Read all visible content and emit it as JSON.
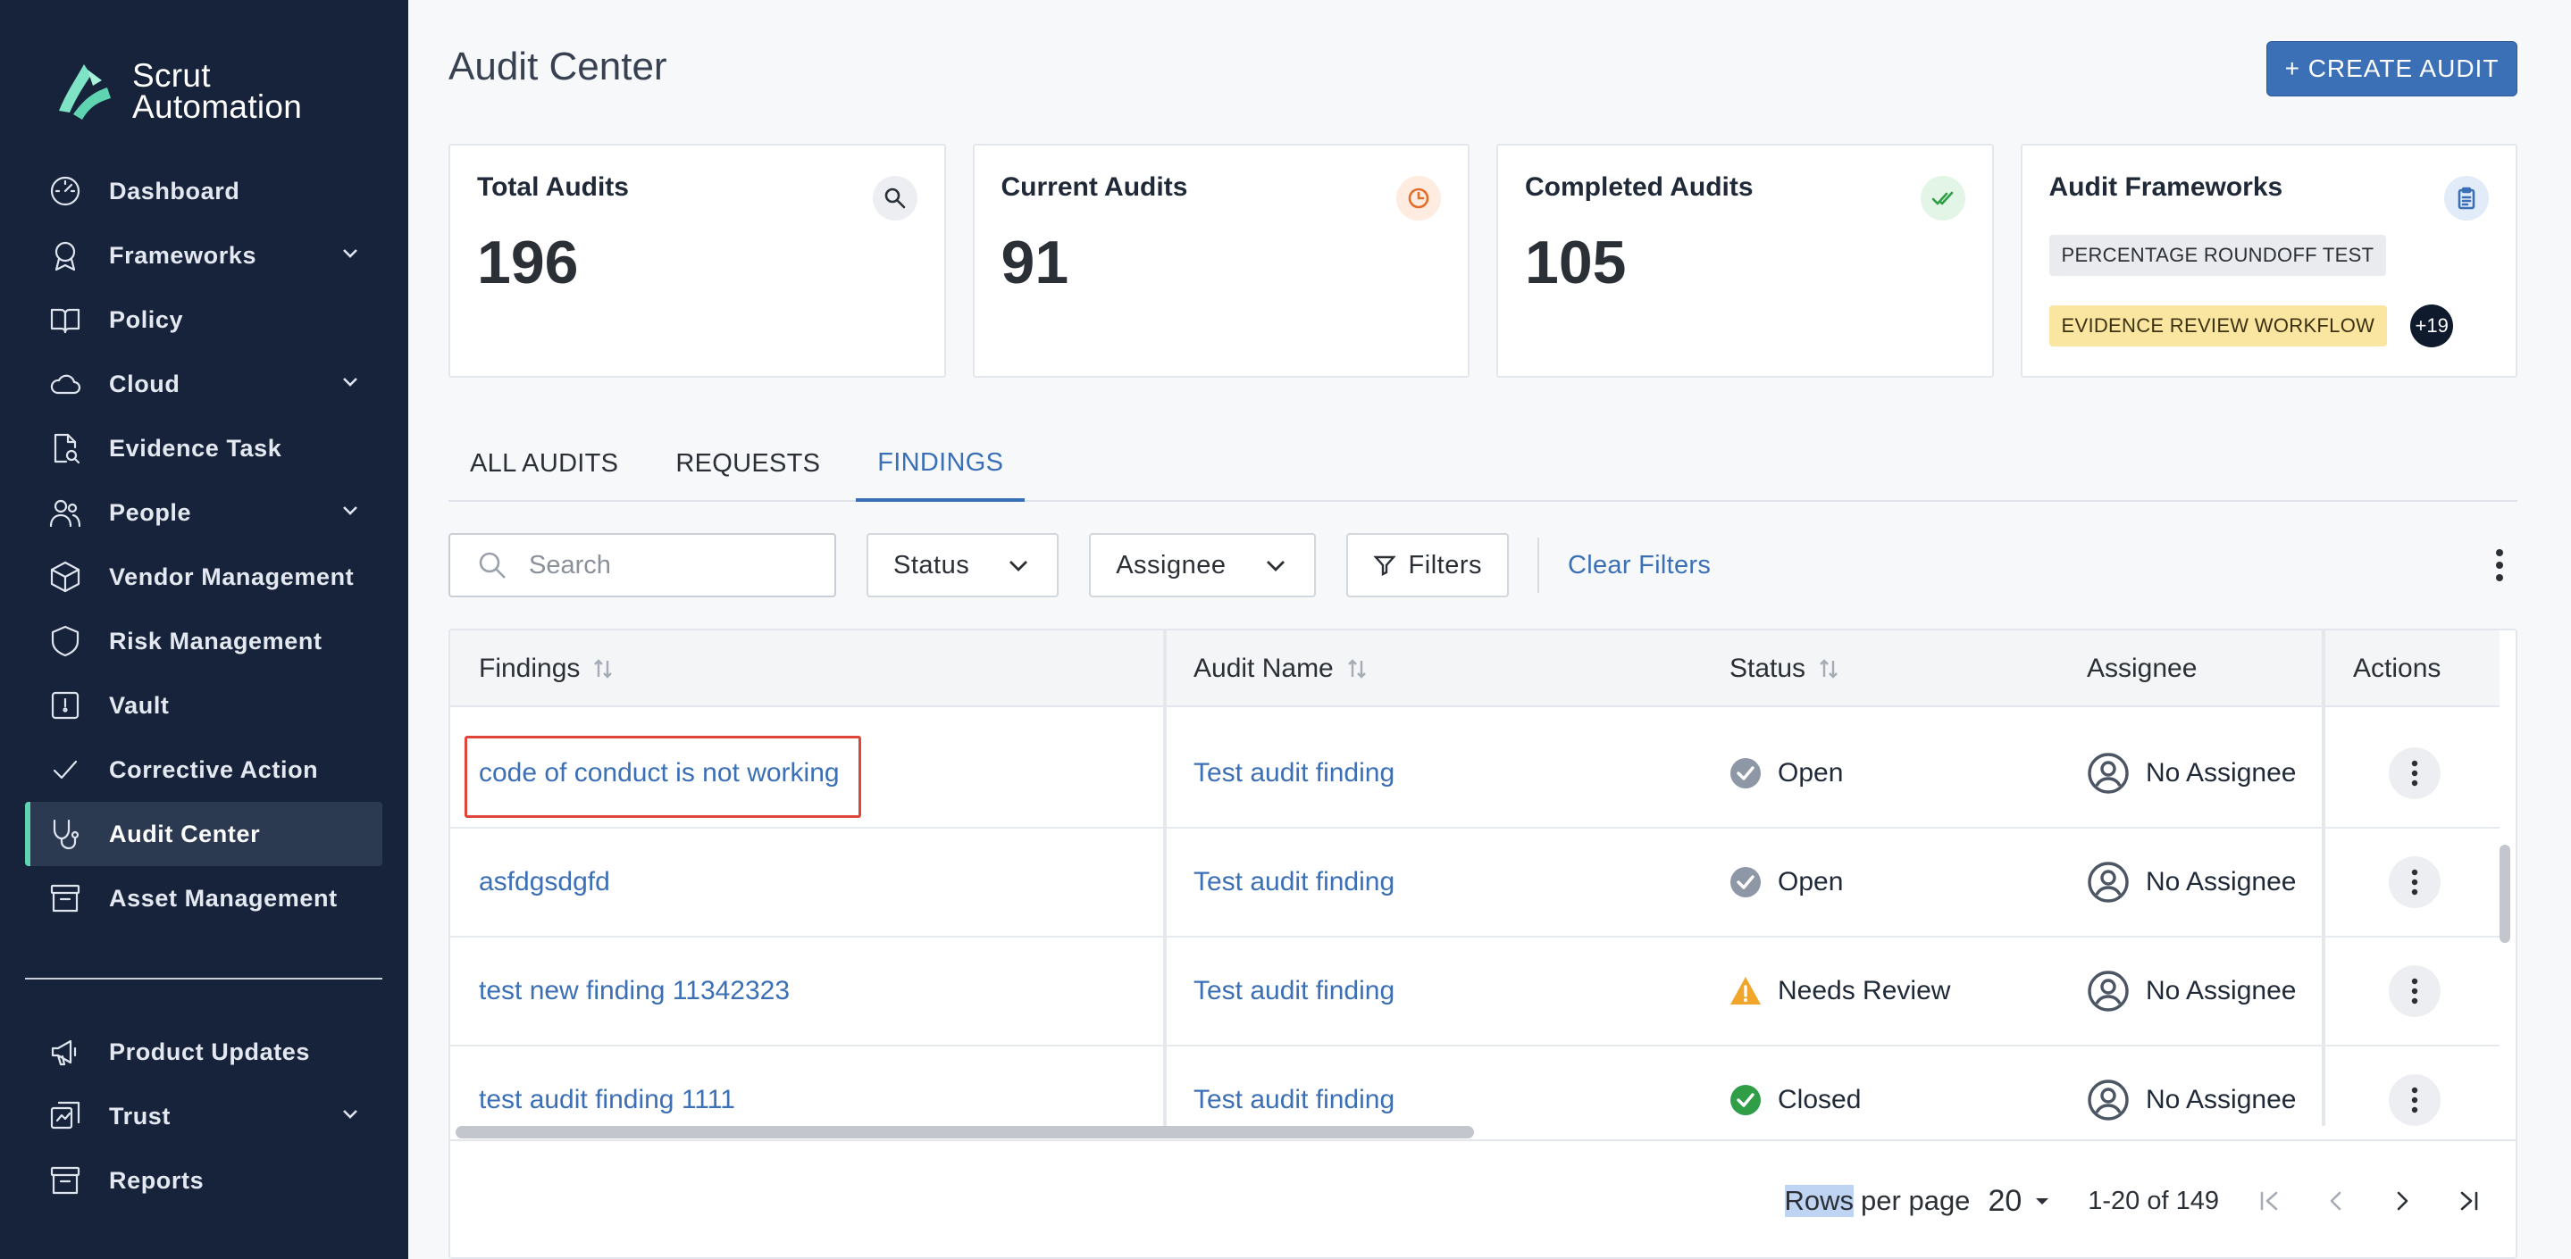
{
  "brand": {
    "line1": "Scrut",
    "line2": "Automation"
  },
  "sidebar": {
    "items": [
      {
        "label": "Dashboard",
        "icon": "dashboard-icon",
        "expandable": false
      },
      {
        "label": "Frameworks",
        "icon": "award-icon",
        "expandable": true
      },
      {
        "label": "Policy",
        "icon": "book-icon",
        "expandable": false
      },
      {
        "label": "Cloud",
        "icon": "cloud-icon",
        "expandable": true
      },
      {
        "label": "Evidence Task",
        "icon": "document-search-icon",
        "expandable": false
      },
      {
        "label": "People",
        "icon": "people-icon",
        "expandable": true
      },
      {
        "label": "Vendor Management",
        "icon": "box-icon",
        "expandable": false
      },
      {
        "label": "Risk Management",
        "icon": "shield-icon",
        "expandable": false
      },
      {
        "label": "Vault",
        "icon": "vault-icon",
        "expandable": false
      },
      {
        "label": "Corrective Action",
        "icon": "check-icon",
        "expandable": false
      },
      {
        "label": "Audit Center",
        "icon": "stethoscope-icon",
        "expandable": false,
        "active": true
      },
      {
        "label": "Asset Management",
        "icon": "archive-icon",
        "expandable": false
      }
    ],
    "secondary": [
      {
        "label": "Product Updates",
        "icon": "megaphone-icon",
        "expandable": false
      },
      {
        "label": "Trust",
        "icon": "trust-icon",
        "expandable": true
      },
      {
        "label": "Reports",
        "icon": "archive-icon",
        "expandable": false
      }
    ]
  },
  "header": {
    "title": "Audit Center",
    "create_label": "+ CREATE AUDIT"
  },
  "cards": {
    "total": {
      "title": "Total Audits",
      "value": "196",
      "icon": "search-icon"
    },
    "current": {
      "title": "Current Audits",
      "value": "91",
      "icon": "clock-icon"
    },
    "completed": {
      "title": "Completed Audits",
      "value": "105",
      "icon": "double-check-icon"
    },
    "frameworks": {
      "title": "Audit Frameworks",
      "icon": "clipboard-icon",
      "chip1": "PERCENTAGE ROUNDOFF TEST",
      "chip2": "EVIDENCE REVIEW WORKFLOW",
      "more": "+19"
    }
  },
  "tabs": [
    {
      "label": "ALL AUDITS"
    },
    {
      "label": "REQUESTS"
    },
    {
      "label": "FINDINGS",
      "active": true
    }
  ],
  "toolbar": {
    "search_placeholder": "Search",
    "status_label": "Status",
    "assignee_label": "Assignee",
    "filters_label": "Filters",
    "clear_label": "Clear Filters"
  },
  "table": {
    "columns": {
      "findings": "Findings",
      "audit_name": "Audit Name",
      "status": "Status",
      "assignee": "Assignee",
      "actions": "Actions"
    },
    "rows": [
      {
        "finding": "code of conduct is not working",
        "audit": "Test audit finding",
        "status": "Open",
        "status_type": "open",
        "assignee": "No Assignee"
      },
      {
        "finding": "asfdgsdgfd",
        "audit": "Test audit finding",
        "status": "Open",
        "status_type": "open",
        "assignee": "No Assignee"
      },
      {
        "finding": "test new finding 11342323",
        "audit": "Test audit finding",
        "status": "Needs Review",
        "status_type": "review",
        "assignee": "No Assignee"
      },
      {
        "finding": "test audit finding 1111",
        "audit": "Test audit finding",
        "status": "Closed",
        "status_type": "closed",
        "assignee": "No Assignee"
      }
    ]
  },
  "pagination": {
    "rows_word": "Rows",
    "per_page": "per page",
    "page_size": "20",
    "range": "1-20 of 149"
  },
  "colors": {
    "sidebar_bg": "#16233a",
    "accent": "#3b6fb6",
    "active_marker": "#5fd4b0",
    "open": "#8e97a6",
    "review": "#f0a62b",
    "closed": "#2f9e47",
    "highlight": "#e0453a"
  }
}
